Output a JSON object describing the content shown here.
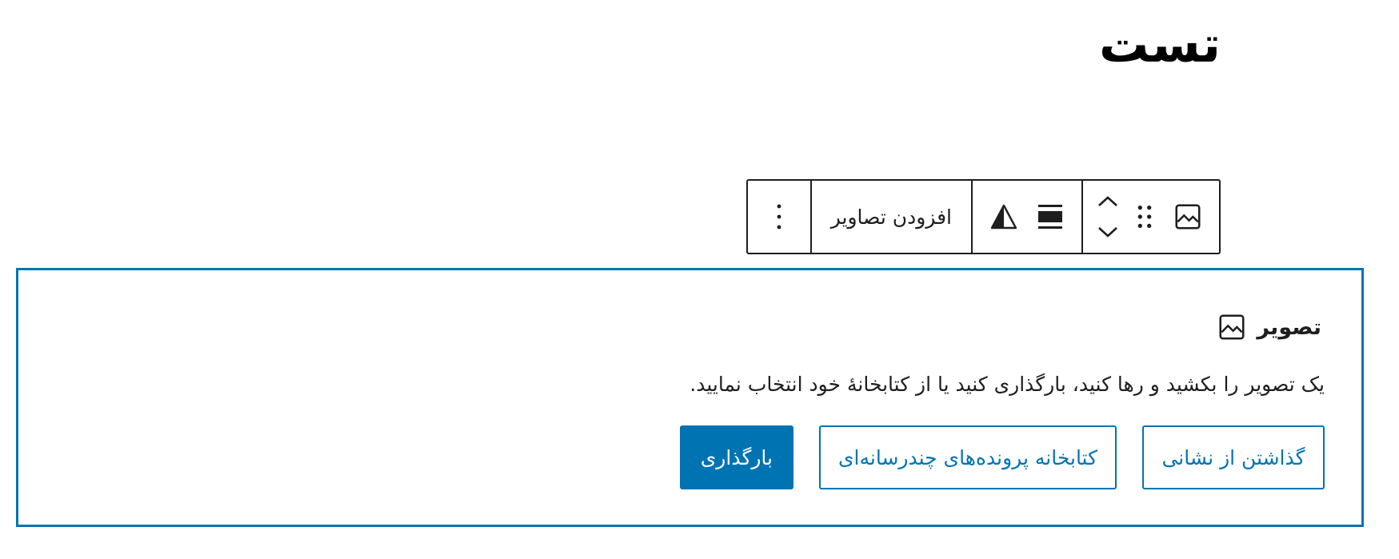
{
  "post": {
    "title": "تست"
  },
  "toolbar": {
    "block_type_icon": "image-icon",
    "drag_icon": "drag-handle-icon",
    "move_up_icon": "chevron-up-icon",
    "move_down_icon": "chevron-down-icon",
    "align_icon": "align-wide-icon",
    "filter_icon": "duotone-filter-icon",
    "add_images_label": "افزودن تصاویر",
    "more_options_icon": "more-vertical-icon"
  },
  "placeholder": {
    "icon": "image-icon",
    "label": "تصویر",
    "instructions": "یک تصویر را بکشید و رها کنید، بارگذاری کنید یا از کتابخانهٔ خود انتخاب نمایید.",
    "upload_label": "بارگذاری",
    "media_library_label": "کتابخانه پرونده‌های چندرسانه‌ای",
    "insert_url_label": "گذاشتن از نشانی"
  },
  "colors": {
    "accent": "#0074b2",
    "text": "#1e1e1e",
    "background": "#ffffff"
  }
}
